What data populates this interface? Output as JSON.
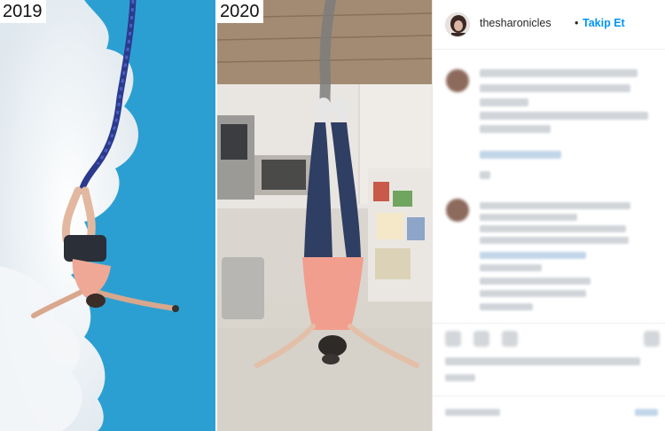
{
  "media": {
    "left_label": "2019",
    "right_label": "2020"
  },
  "header": {
    "username": "thesharonicles",
    "separator": "•",
    "follow_label": "Takip Et"
  },
  "colors": {
    "sky": "#2b9fd3",
    "follow_blue": "#0095f6",
    "blur_text": "#c9ced3",
    "blur_link": "#b8cfe6"
  },
  "icons": [
    "like-icon",
    "comment-icon",
    "share-icon",
    "save-icon"
  ]
}
